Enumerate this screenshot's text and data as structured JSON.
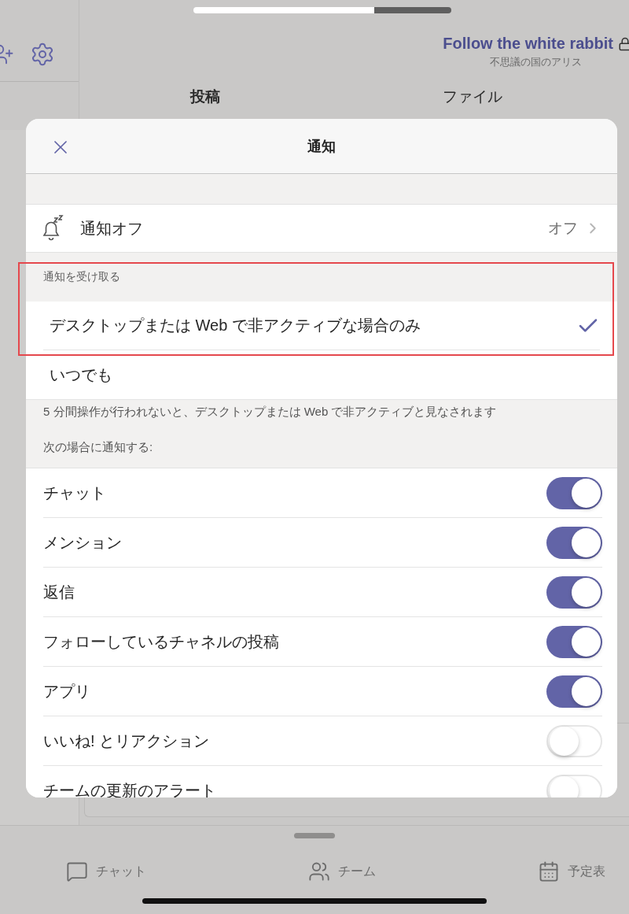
{
  "header": {
    "title": "Follow the white rabbit",
    "subtitle": "不思議の国のアリス",
    "tabs": [
      {
        "label": "投稿",
        "selected": true
      },
      {
        "label": "ファイル",
        "selected": false
      }
    ]
  },
  "dialog": {
    "title": "通知",
    "snooze": {
      "label": "通知オフ",
      "value": "オフ"
    },
    "receive": {
      "heading": "通知を受け取る",
      "highlighted": true,
      "options": [
        {
          "label": "デスクトップまたは Web で非アクティブな場合のみ",
          "selected": true
        },
        {
          "label": "いつでも",
          "selected": false
        }
      ]
    },
    "note": "5 分間操作が行われないと、デスクトップまたは Web で非アクティブと見なされます",
    "notify_heading": "次の場合に通知する:",
    "toggles": [
      {
        "label": "チャット",
        "on": true
      },
      {
        "label": "メンション",
        "on": true
      },
      {
        "label": "返信",
        "on": true
      },
      {
        "label": "フォローしているチャネルの投稿",
        "on": true
      },
      {
        "label": "アプリ",
        "on": true
      },
      {
        "label": "いいね! とリアクション",
        "on": false
      },
      {
        "label": "チームの更新のアラート",
        "on": false
      }
    ]
  },
  "bottom_nav": [
    {
      "label": "チャット"
    },
    {
      "label": "チーム"
    },
    {
      "label": "予定表"
    }
  ]
}
